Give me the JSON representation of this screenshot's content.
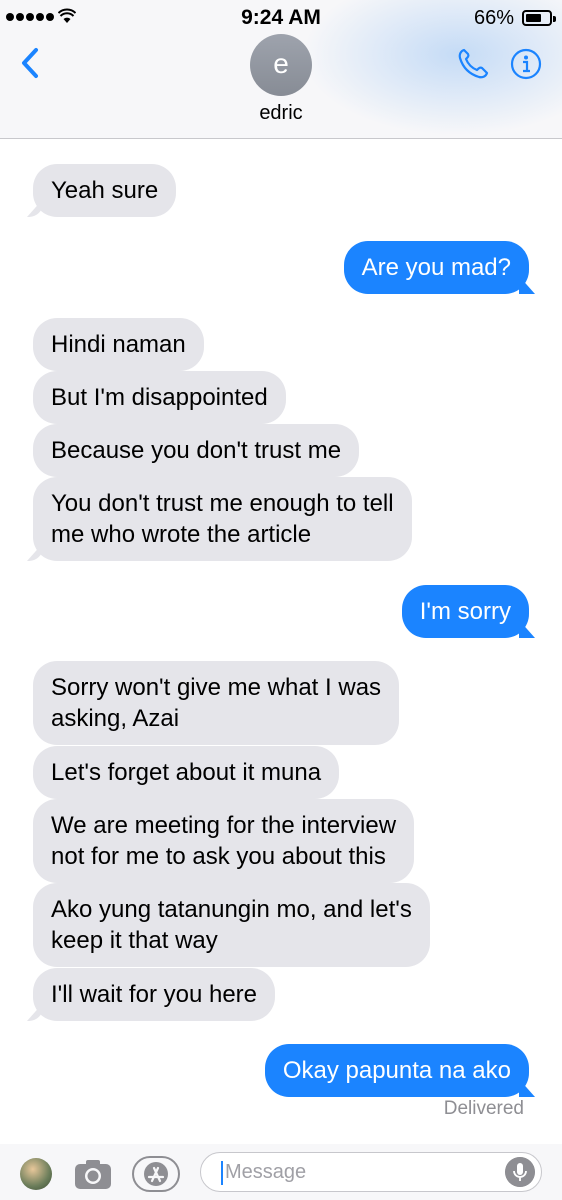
{
  "status": {
    "time": "9:24 AM",
    "battery": "66%",
    "battery_level": 0.66
  },
  "contact": {
    "initial": "e",
    "name": "edric"
  },
  "messages": [
    {
      "dir": "in",
      "text": "Yeah sure"
    },
    {
      "dir": "out",
      "text": "Are you mad?"
    },
    {
      "dir": "in",
      "text": "Hindi naman"
    },
    {
      "dir": "in",
      "text": "But I'm disappointed"
    },
    {
      "dir": "in",
      "text": "Because you don't trust me"
    },
    {
      "dir": "in",
      "lines": [
        "You don't trust me enough to tell",
        "me who wrote the article"
      ]
    },
    {
      "dir": "out",
      "text": "I'm sorry"
    },
    {
      "dir": "in",
      "lines": [
        "Sorry won't give me what I was",
        "asking, Azai"
      ]
    },
    {
      "dir": "in",
      "text": "Let's forget about it muna"
    },
    {
      "dir": "in",
      "lines": [
        "We are meeting for the interview",
        "not for me to ask you about this"
      ]
    },
    {
      "dir": "in",
      "lines": [
        "Ako yung tatanungin mo, and let's",
        "keep it that way"
      ]
    },
    {
      "dir": "in",
      "text": "I'll wait for you here"
    },
    {
      "dir": "out",
      "text": "Okay papunta na ako"
    }
  ],
  "delivered_label": "Delivered",
  "composer": {
    "placeholder": "Message"
  },
  "colors": {
    "outgoing": "#1b84ff",
    "incoming": "#e5e5ea",
    "accent": "#1b84ff"
  },
  "icons": {
    "back": "chevron-left-icon",
    "call": "phone-icon",
    "info": "info-icon",
    "camera": "camera-icon",
    "appstore": "app-store-icon",
    "mic": "microphone-icon"
  }
}
